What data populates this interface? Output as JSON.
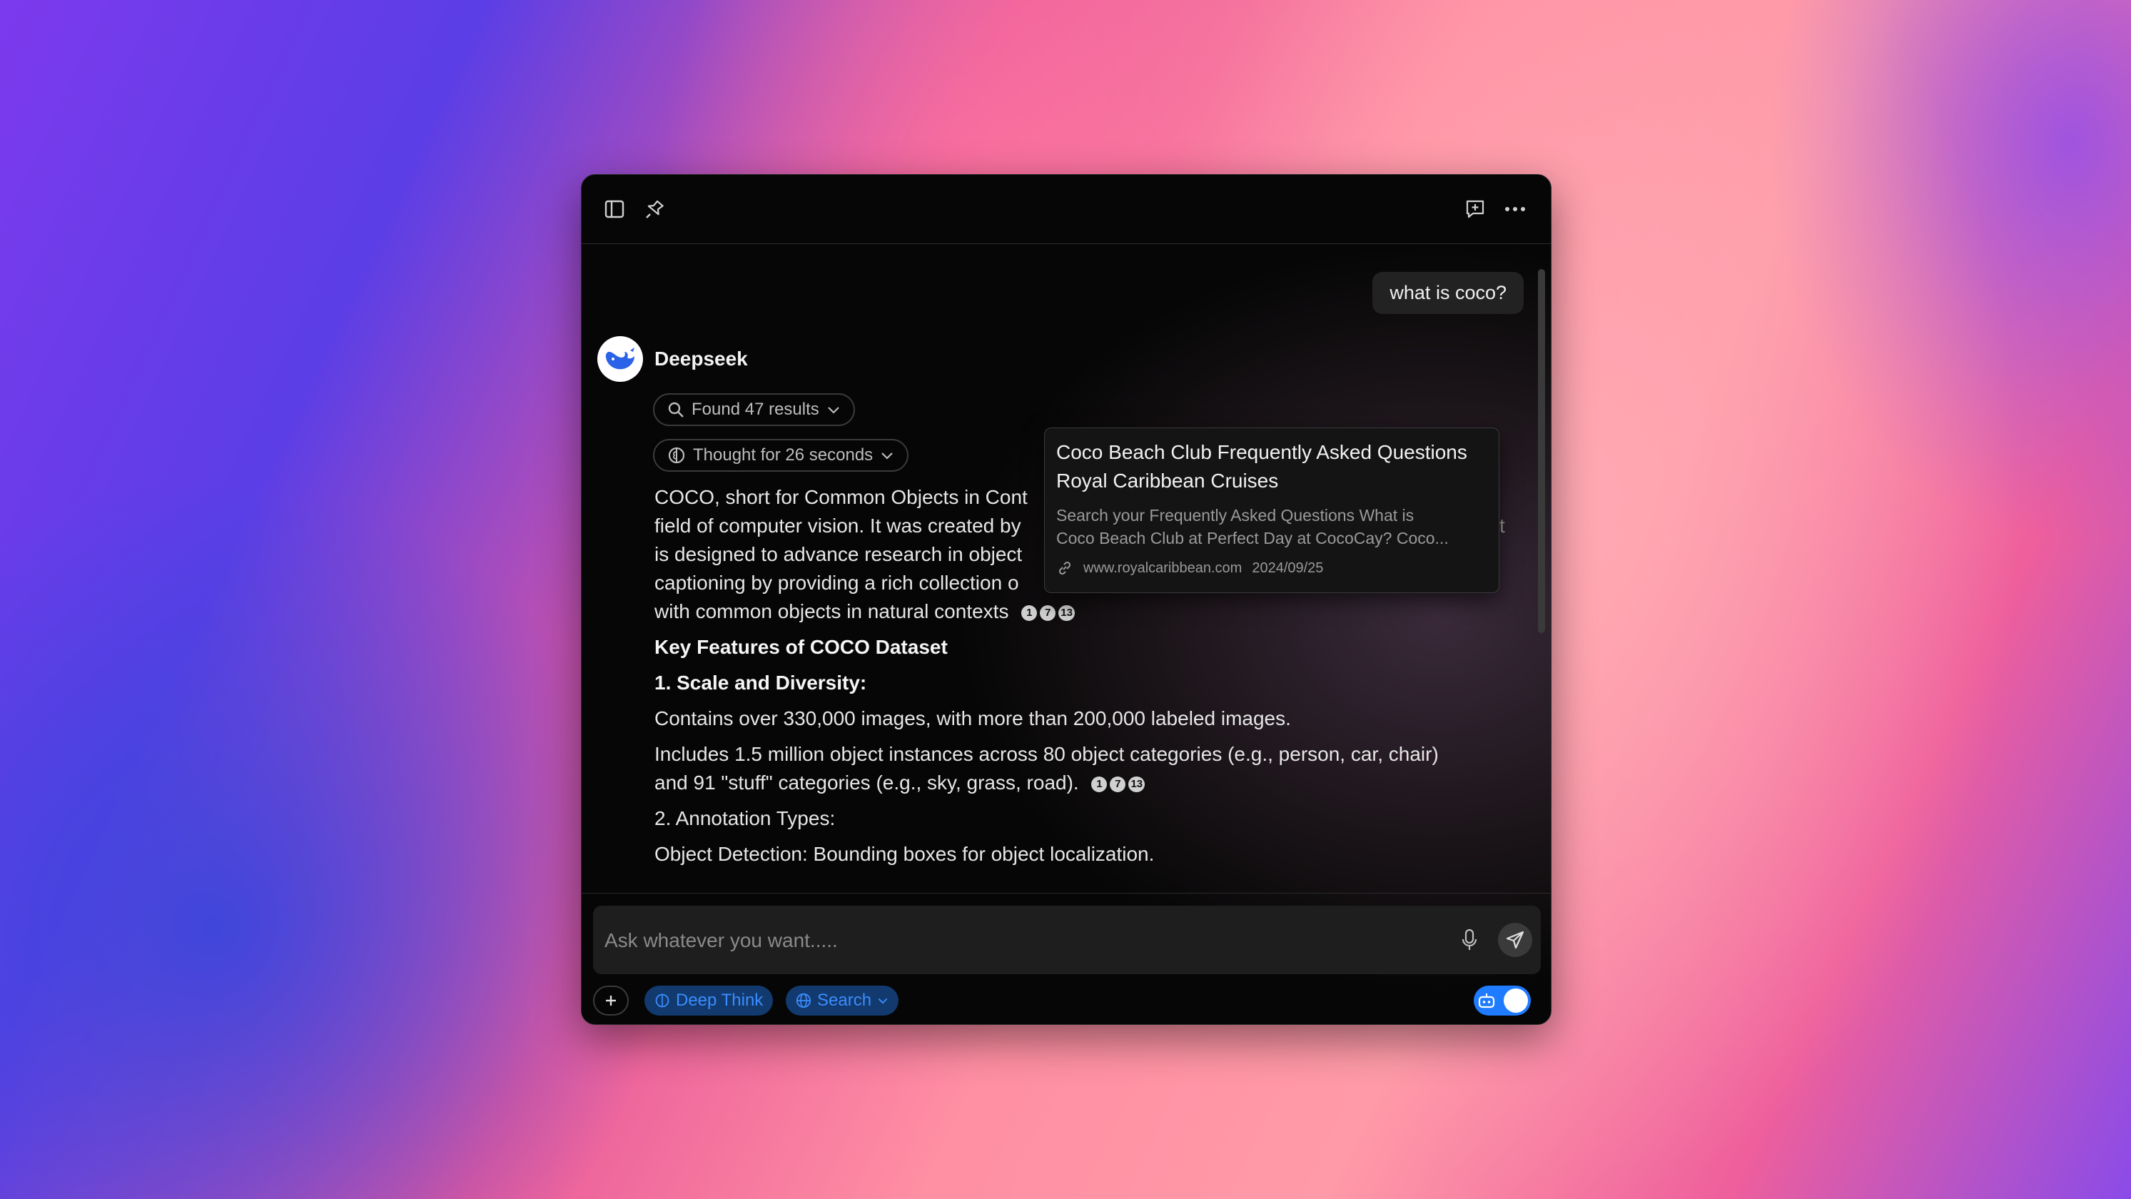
{
  "colors": {
    "accent": "#1f7bff",
    "chip_bg": "#123a6e",
    "chip_text": "#3b8cff"
  },
  "toolbar": {
    "left_icons": [
      "sidebar-icon",
      "pin-icon"
    ],
    "right_icons": [
      "new-chat-icon",
      "more-icon"
    ]
  },
  "chat": {
    "user_message": "what is coco?",
    "bot_name": "Deepseek",
    "search_pill": "Found 47 results",
    "thought_pill": "Thought for 26 seconds",
    "para1": [
      "COCO, short for Common Objects in Cont",
      "field of computer vision. It was created by",
      "is designed to advance research in object",
      "captioning by providing a rich collection o",
      "with common objects in natural contexts"
    ],
    "para1_overflow_char": "t",
    "citations": [
      "1",
      "7",
      "13"
    ],
    "heading": "Key Features of COCO Dataset",
    "sub1": "1. Scale and Diversity:",
    "bullet1": "Contains over 330,000 images, with more than 200,000 labeled images.",
    "bullet2_l1": "Includes 1.5 million object instances across 80 object categories (e.g., person, car, chair)",
    "bullet2_l2": "and 91 \"stuff\" categories (e.g., sky, grass, road).",
    "sub2": "2. Annotation Types:",
    "bullet3": "Object Detection: Bounding boxes for object localization."
  },
  "tooltip": {
    "title_l1": "Coco Beach Club Frequently Asked Questions",
    "title_l2": "Royal Caribbean Cruises",
    "desc_l1": "Search your Frequently Asked Questions What is",
    "desc_l2": "Coco Beach Club at Perfect Day at CocoCay? Coco...",
    "domain": "www.royalcaribbean.com",
    "date": "2024/09/25"
  },
  "input": {
    "placeholder": "Ask whatever you want....."
  },
  "bottom": {
    "deep_think": "Deep Think",
    "search": "Search"
  }
}
